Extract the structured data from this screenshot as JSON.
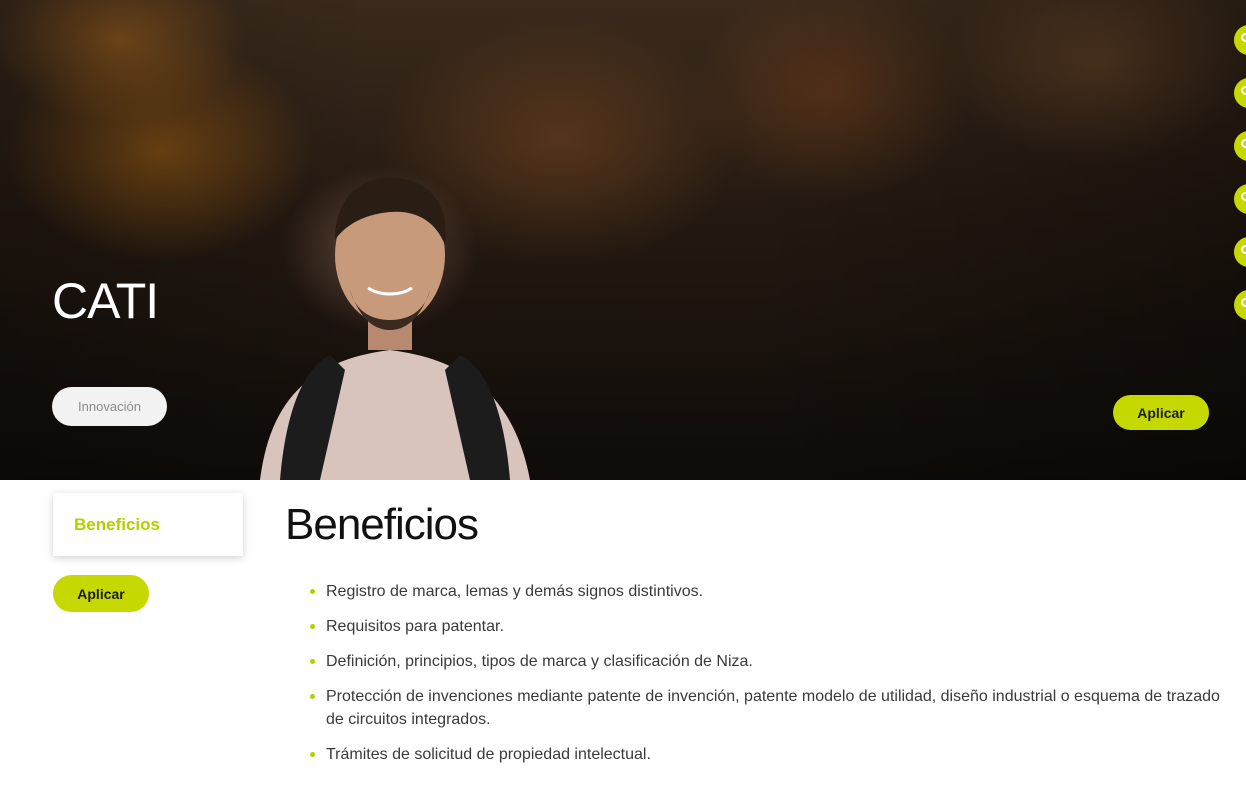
{
  "hero": {
    "title": "CATI",
    "tag": "Innovación",
    "apply_label": "Aplicar"
  },
  "side_nav": {
    "active_item": "Beneficios",
    "apply_label": "Aplicar"
  },
  "content": {
    "heading": "Beneficios",
    "items": [
      "Registro de marca, lemas y demás signos distintivos.",
      "Requisitos para patentar.",
      "Definición, principios, tipos de marca y clasificación de Niza.",
      "Protección de invenciones mediante patente de invención, patente modelo de utilidad, diseño industrial o esquema de trazado de circuitos integrados.",
      "Trámites de solicitud de propiedad intelectual."
    ]
  },
  "colors": {
    "accent": "#c5d800",
    "accent_text": "#b3cf00"
  },
  "icons": {
    "side_rail": [
      "share-icon",
      "share-icon",
      "share-icon",
      "share-icon",
      "share-icon",
      "share-icon"
    ]
  }
}
